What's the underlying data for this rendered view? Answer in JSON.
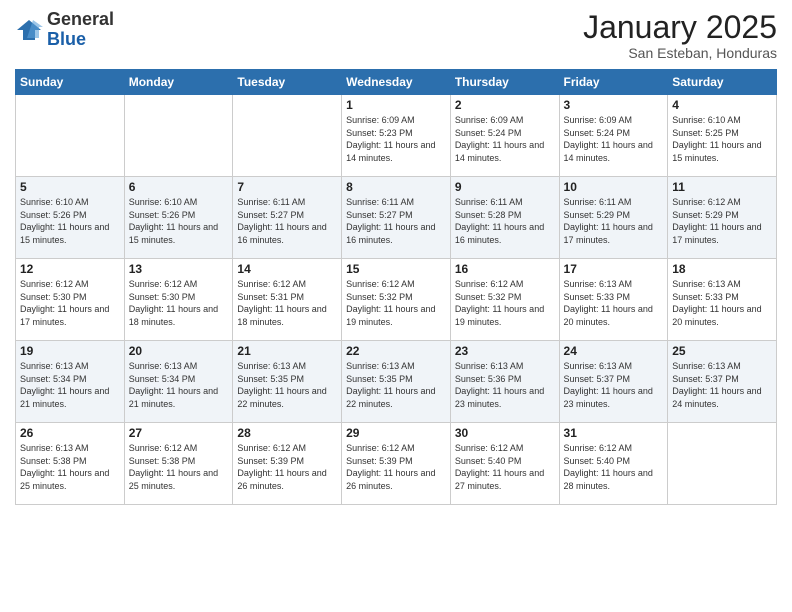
{
  "logo": {
    "general": "General",
    "blue": "Blue"
  },
  "title": "January 2025",
  "location": "San Esteban, Honduras",
  "days_of_week": [
    "Sunday",
    "Monday",
    "Tuesday",
    "Wednesday",
    "Thursday",
    "Friday",
    "Saturday"
  ],
  "weeks": [
    [
      {
        "day": "",
        "info": ""
      },
      {
        "day": "",
        "info": ""
      },
      {
        "day": "",
        "info": ""
      },
      {
        "day": "1",
        "info": "Sunrise: 6:09 AM\nSunset: 5:23 PM\nDaylight: 11 hours and 14 minutes."
      },
      {
        "day": "2",
        "info": "Sunrise: 6:09 AM\nSunset: 5:24 PM\nDaylight: 11 hours and 14 minutes."
      },
      {
        "day": "3",
        "info": "Sunrise: 6:09 AM\nSunset: 5:24 PM\nDaylight: 11 hours and 14 minutes."
      },
      {
        "day": "4",
        "info": "Sunrise: 6:10 AM\nSunset: 5:25 PM\nDaylight: 11 hours and 15 minutes."
      }
    ],
    [
      {
        "day": "5",
        "info": "Sunrise: 6:10 AM\nSunset: 5:26 PM\nDaylight: 11 hours and 15 minutes."
      },
      {
        "day": "6",
        "info": "Sunrise: 6:10 AM\nSunset: 5:26 PM\nDaylight: 11 hours and 15 minutes."
      },
      {
        "day": "7",
        "info": "Sunrise: 6:11 AM\nSunset: 5:27 PM\nDaylight: 11 hours and 16 minutes."
      },
      {
        "day": "8",
        "info": "Sunrise: 6:11 AM\nSunset: 5:27 PM\nDaylight: 11 hours and 16 minutes."
      },
      {
        "day": "9",
        "info": "Sunrise: 6:11 AM\nSunset: 5:28 PM\nDaylight: 11 hours and 16 minutes."
      },
      {
        "day": "10",
        "info": "Sunrise: 6:11 AM\nSunset: 5:29 PM\nDaylight: 11 hours and 17 minutes."
      },
      {
        "day": "11",
        "info": "Sunrise: 6:12 AM\nSunset: 5:29 PM\nDaylight: 11 hours and 17 minutes."
      }
    ],
    [
      {
        "day": "12",
        "info": "Sunrise: 6:12 AM\nSunset: 5:30 PM\nDaylight: 11 hours and 17 minutes."
      },
      {
        "day": "13",
        "info": "Sunrise: 6:12 AM\nSunset: 5:30 PM\nDaylight: 11 hours and 18 minutes."
      },
      {
        "day": "14",
        "info": "Sunrise: 6:12 AM\nSunset: 5:31 PM\nDaylight: 11 hours and 18 minutes."
      },
      {
        "day": "15",
        "info": "Sunrise: 6:12 AM\nSunset: 5:32 PM\nDaylight: 11 hours and 19 minutes."
      },
      {
        "day": "16",
        "info": "Sunrise: 6:12 AM\nSunset: 5:32 PM\nDaylight: 11 hours and 19 minutes."
      },
      {
        "day": "17",
        "info": "Sunrise: 6:13 AM\nSunset: 5:33 PM\nDaylight: 11 hours and 20 minutes."
      },
      {
        "day": "18",
        "info": "Sunrise: 6:13 AM\nSunset: 5:33 PM\nDaylight: 11 hours and 20 minutes."
      }
    ],
    [
      {
        "day": "19",
        "info": "Sunrise: 6:13 AM\nSunset: 5:34 PM\nDaylight: 11 hours and 21 minutes."
      },
      {
        "day": "20",
        "info": "Sunrise: 6:13 AM\nSunset: 5:34 PM\nDaylight: 11 hours and 21 minutes."
      },
      {
        "day": "21",
        "info": "Sunrise: 6:13 AM\nSunset: 5:35 PM\nDaylight: 11 hours and 22 minutes."
      },
      {
        "day": "22",
        "info": "Sunrise: 6:13 AM\nSunset: 5:35 PM\nDaylight: 11 hours and 22 minutes."
      },
      {
        "day": "23",
        "info": "Sunrise: 6:13 AM\nSunset: 5:36 PM\nDaylight: 11 hours and 23 minutes."
      },
      {
        "day": "24",
        "info": "Sunrise: 6:13 AM\nSunset: 5:37 PM\nDaylight: 11 hours and 23 minutes."
      },
      {
        "day": "25",
        "info": "Sunrise: 6:13 AM\nSunset: 5:37 PM\nDaylight: 11 hours and 24 minutes."
      }
    ],
    [
      {
        "day": "26",
        "info": "Sunrise: 6:13 AM\nSunset: 5:38 PM\nDaylight: 11 hours and 25 minutes."
      },
      {
        "day": "27",
        "info": "Sunrise: 6:12 AM\nSunset: 5:38 PM\nDaylight: 11 hours and 25 minutes."
      },
      {
        "day": "28",
        "info": "Sunrise: 6:12 AM\nSunset: 5:39 PM\nDaylight: 11 hours and 26 minutes."
      },
      {
        "day": "29",
        "info": "Sunrise: 6:12 AM\nSunset: 5:39 PM\nDaylight: 11 hours and 26 minutes."
      },
      {
        "day": "30",
        "info": "Sunrise: 6:12 AM\nSunset: 5:40 PM\nDaylight: 11 hours and 27 minutes."
      },
      {
        "day": "31",
        "info": "Sunrise: 6:12 AM\nSunset: 5:40 PM\nDaylight: 11 hours and 28 minutes."
      },
      {
        "day": "",
        "info": ""
      }
    ]
  ]
}
